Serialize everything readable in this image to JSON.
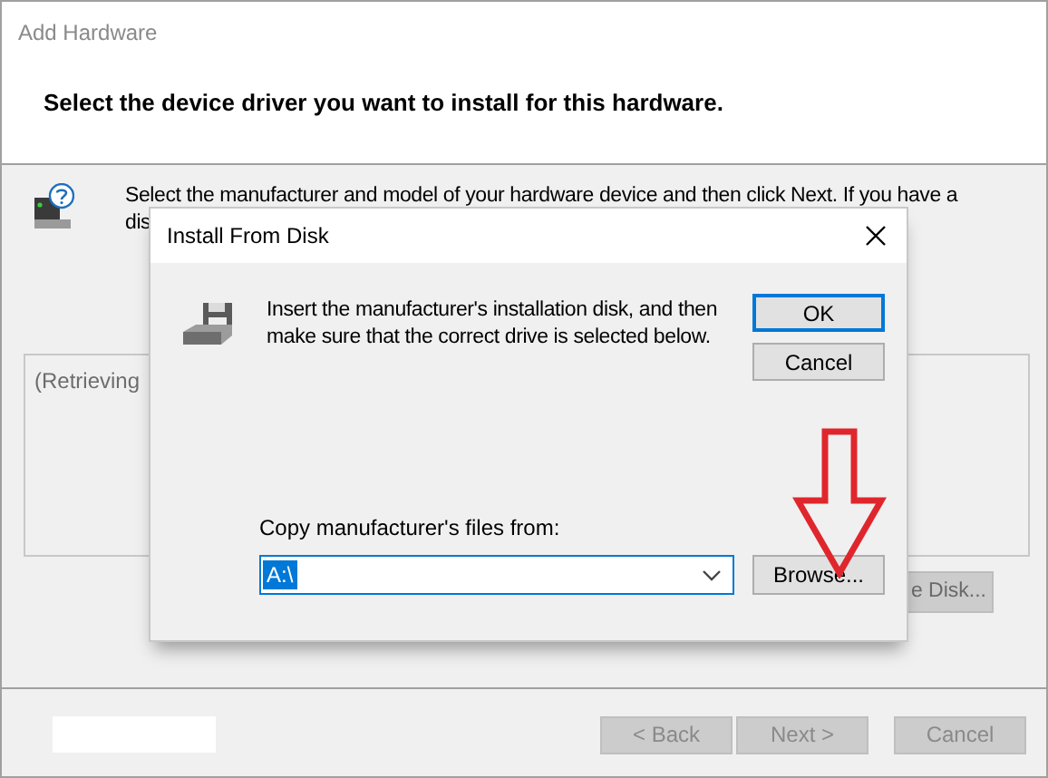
{
  "window": {
    "title": "Add Hardware",
    "heading": "Select the device driver you want to install for this hardware."
  },
  "instruction_lines": [
    "Select the manufacturer and model of your hardware device and then click Next. If you have a",
    "dis"
  ],
  "list_text": "(Retrieving",
  "have_disk_button": {
    "label": "e Disk...",
    "disabled": true
  },
  "nav_buttons": [
    {
      "label": "< Back",
      "disabled": true
    },
    {
      "label": "Next >",
      "disabled": true
    },
    {
      "label": "Cancel",
      "disabled": true
    }
  ],
  "dialog": {
    "title": "Install From Disk",
    "message": "Insert the manufacturer's installation disk, and then make sure that the correct drive is selected below.",
    "buttons": [
      {
        "label": "OK",
        "default": true
      },
      {
        "label": "Cancel",
        "default": false
      }
    ],
    "path_label": "Copy manufacturer's files from:",
    "path_value": "A:\\",
    "path_selected": true,
    "browse_button": "Browse..."
  }
}
